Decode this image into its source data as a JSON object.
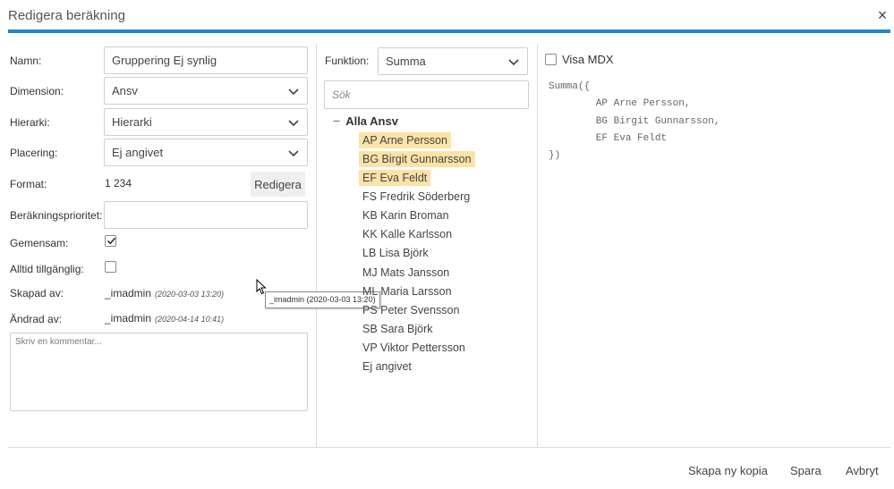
{
  "dialog": {
    "title": "Redigera beräkning",
    "close_symbol": "×"
  },
  "form": {
    "name_label": "Namn:",
    "name_value": "Gruppering Ej synlig",
    "dimension_label": "Dimension:",
    "dimension_value": "Ansv",
    "hierarchy_label": "Hierarki:",
    "hierarchy_value": "Hierarki",
    "placement_label": "Placering:",
    "placement_value": "Ej angivet",
    "format_label": "Format:",
    "format_value": "1 234",
    "format_edit_button": "Redigera",
    "priority_label": "Beräkningsprioritet:",
    "priority_value": "",
    "shared_label": "Gemensam:",
    "shared_checked": true,
    "always_available_label": "Alltid tillgänglig:",
    "always_available_checked": false,
    "created_label": "Skapad av:",
    "created_user": "_imadmin",
    "created_time": "(2020-03-03 13:20)",
    "changed_label": "Ändrad av:",
    "changed_user": "_imadmin",
    "changed_time": "(2020-04-14 10:41)",
    "comment_placeholder": "Skriv en kommentar..."
  },
  "tooltip": {
    "text": "_imadmin (2020-03-03 13:20)"
  },
  "members": {
    "function_label": "Funktion:",
    "function_value": "Summa",
    "search_placeholder": "Sök",
    "tree_toggle": "−",
    "root_label": "Alla Ansv",
    "items": [
      {
        "label": "AP Arne Persson",
        "selected": true
      },
      {
        "label": "BG Birgit Gunnarsson",
        "selected": true
      },
      {
        "label": "EF Eva Feldt",
        "selected": true
      },
      {
        "label": "FS Fredrik Söderberg",
        "selected": false
      },
      {
        "label": "KB Karin Broman",
        "selected": false
      },
      {
        "label": "KK Kalle Karlsson",
        "selected": false
      },
      {
        "label": "LB Lisa Björk",
        "selected": false
      },
      {
        "label": "MJ Mats Jansson",
        "selected": false
      },
      {
        "label": "ML Maria Larsson",
        "selected": false
      },
      {
        "label": "PS Peter Svensson",
        "selected": false
      },
      {
        "label": "SB Sara Björk",
        "selected": false
      },
      {
        "label": "VP Viktor Pettersson",
        "selected": false
      },
      {
        "label": "Ej angivet",
        "selected": false
      }
    ]
  },
  "mdx": {
    "show_label": "Visa MDX",
    "show_checked": false,
    "code": "Summa({\n        AP Arne Persson,\n        BG Birgit Gunnarsson,\n        EF Eva Feldt\n})"
  },
  "footer": {
    "copy_button": "Skapa ny kopia",
    "save_button": "Spara",
    "cancel_button": "Avbryt"
  },
  "colors": {
    "accent": "#1e88d0",
    "selection": "#fbe3a7"
  }
}
